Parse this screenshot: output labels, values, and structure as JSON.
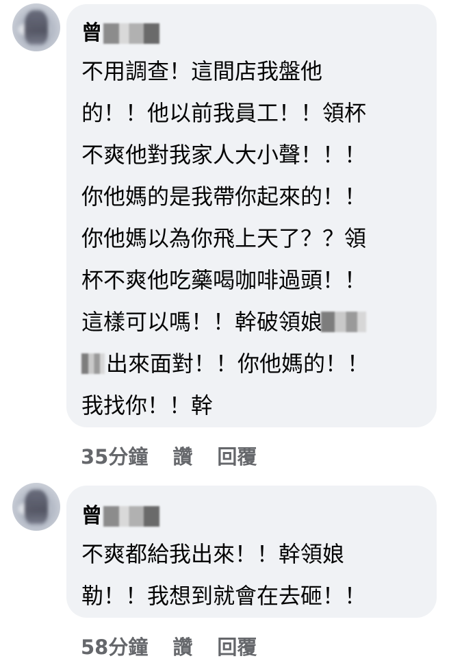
{
  "comments": [
    {
      "author": "曾",
      "lines": [
        "不用調查！這間店我盤他",
        "的！！他以前我員工！！領杯",
        "不爽他對我家人大小聲！！！",
        "你他媽的是我帶你起來的！！",
        "你他媽以為你飛上天了？？領",
        "杯不爽他吃藥喝咖啡過頭！！",
        "這樣可以嗎！！幹破領娘"
      ],
      "line8": "出來面對！！你他媽的！！",
      "last_line": "我找你！！幹",
      "time": "35分鐘",
      "like": "讚",
      "reply": "回覆"
    },
    {
      "author": "曾",
      "lines": [
        "不爽都給我出來！！幹領娘",
        "勒！！我想到就會在去砸！！"
      ],
      "time": "58分鐘",
      "like": "讚",
      "reply": "回覆"
    }
  ],
  "colors": {
    "bubble": "#f0f2f5",
    "text": "#050505",
    "meta": "#65676b"
  }
}
